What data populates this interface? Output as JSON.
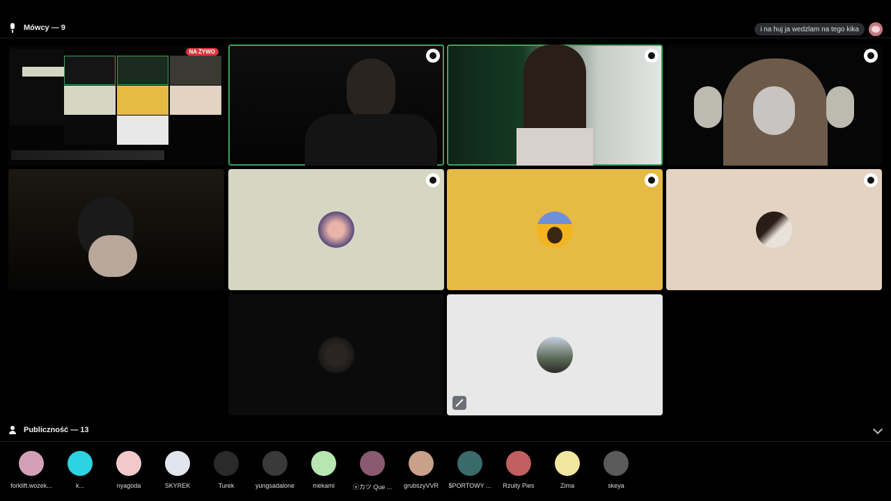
{
  "speakers": {
    "label": "Mówcy — 9",
    "icon": "microphone-icon"
  },
  "status": {
    "text": "i na huj ja wedzlam na tego kika"
  },
  "screen_share": {
    "badge": "NA ŻYWO"
  },
  "audience": {
    "label": "Publiczność — 13",
    "icon": "people-icon",
    "members": [
      {
        "name": "forklift.wozek..."
      },
      {
        "name": "k..."
      },
      {
        "name": "nyagoda"
      },
      {
        "name": "SKYREK"
      },
      {
        "name": "Turek"
      },
      {
        "name": "yungsadalone"
      },
      {
        "name": "mekami"
      },
      {
        "name": "ⓐカツ Que ..."
      },
      {
        "name": "grubszyVVR"
      },
      {
        "name": "$PORTOWY ..."
      },
      {
        "name": "Rzuity Pies"
      },
      {
        "name": "Zima"
      },
      {
        "name": "skeya"
      }
    ]
  },
  "colors": {
    "background": "#000000",
    "speaking_ring": "#3ba55d",
    "live_badge": "#da373c",
    "tile_beige": "#d6d7c3",
    "tile_yellow": "#e6bb45",
    "tile_tan": "#e2d3c2",
    "tile_dark": "#0b0b0b",
    "tile_light": "#e8e8e8"
  }
}
